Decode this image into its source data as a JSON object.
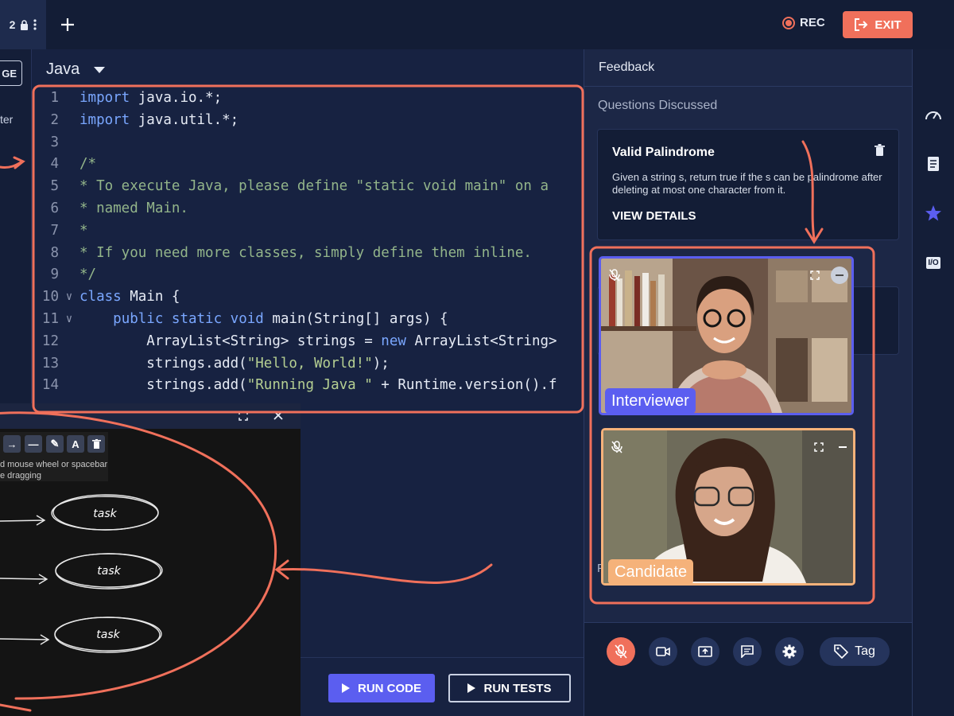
{
  "topbar": {
    "tab_partial": "2",
    "rec_label": "REC",
    "exit_label": "EXIT"
  },
  "left": {
    "button_partial": "GE",
    "text_partial": "ter"
  },
  "editor": {
    "language": "Java",
    "lines": [
      {
        "n": "1",
        "fold": "",
        "parts": [
          {
            "c": "kw",
            "t": "import "
          },
          {
            "c": "txt",
            "t": "java.io.*;"
          }
        ]
      },
      {
        "n": "2",
        "fold": "",
        "parts": [
          {
            "c": "kw",
            "t": "import "
          },
          {
            "c": "txt",
            "t": "java.util.*;"
          }
        ]
      },
      {
        "n": "3",
        "fold": "",
        "parts": []
      },
      {
        "n": "4",
        "fold": "",
        "parts": [
          {
            "c": "cm",
            "t": "/*"
          }
        ]
      },
      {
        "n": "5",
        "fold": "",
        "parts": [
          {
            "c": "cm",
            "t": "* To execute Java, please define \"static void main\" on a"
          }
        ]
      },
      {
        "n": "6",
        "fold": "",
        "parts": [
          {
            "c": "cm",
            "t": "* named Main."
          }
        ]
      },
      {
        "n": "7",
        "fold": "",
        "parts": [
          {
            "c": "cm",
            "t": "*"
          }
        ]
      },
      {
        "n": "8",
        "fold": "",
        "parts": [
          {
            "c": "cm",
            "t": "* If you need more classes, simply define them inline."
          }
        ]
      },
      {
        "n": "9",
        "fold": "",
        "parts": [
          {
            "c": "cm",
            "t": "*/"
          }
        ]
      },
      {
        "n": "10",
        "fold": "∨",
        "parts": [
          {
            "c": "kw",
            "t": "class "
          },
          {
            "c": "txt",
            "t": "Main {"
          }
        ]
      },
      {
        "n": "11",
        "fold": "∨",
        "parts": [
          {
            "c": "txt",
            "t": "    "
          },
          {
            "c": "kw",
            "t": "public static void "
          },
          {
            "c": "txt",
            "t": "main(String[] args) {"
          }
        ]
      },
      {
        "n": "12",
        "fold": "",
        "parts": [
          {
            "c": "txt",
            "t": "        ArrayList<String> strings = "
          },
          {
            "c": "kw",
            "t": "new "
          },
          {
            "c": "txt",
            "t": "ArrayList<String>"
          }
        ]
      },
      {
        "n": "13",
        "fold": "",
        "parts": [
          {
            "c": "txt",
            "t": "        strings.add("
          },
          {
            "c": "st",
            "t": "\"Hello, World!\""
          },
          {
            "c": "txt",
            "t": ");"
          }
        ]
      },
      {
        "n": "14",
        "fold": "",
        "parts": [
          {
            "c": "txt",
            "t": "        strings.add("
          },
          {
            "c": "st",
            "t": "\"Running Java \""
          },
          {
            "c": "txt",
            "t": " + Runtime.version().f"
          }
        ]
      }
    ],
    "run_code_label": "RUN CODE",
    "run_tests_label": "RUN TESTS"
  },
  "whiteboard": {
    "hint_line1": "d mouse wheel or spacebar",
    "hint_line2": "e dragging",
    "text_tool": "A",
    "nodes": [
      "task",
      "task",
      "task"
    ]
  },
  "feedback": {
    "title": "Feedback",
    "questions_label": "Questions Discussed",
    "question": {
      "title": "Valid Palindrome",
      "description": "Given a string s, return true if the s can be palindrome after deleting at most one character from it.",
      "link": "VIEW DETAILS"
    },
    "hidden_label_partial": "F",
    "tag_label": "Tag"
  },
  "videos": {
    "interviewer_label": "Interviewer",
    "candidate_label": "Candidate"
  },
  "rail": {
    "io_label": "I/O"
  },
  "colors": {
    "accent": "#f0705b",
    "primary_button": "#5b5ef0",
    "interviewer_border": "#5b5ef0",
    "candidate_border": "#f5b27a",
    "background": "#18233f"
  }
}
